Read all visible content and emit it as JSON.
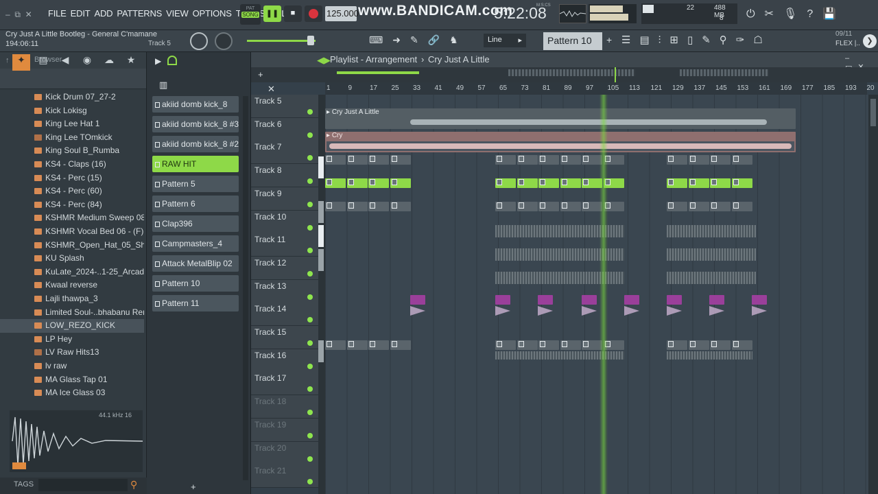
{
  "menu": [
    "FILE",
    "EDIT",
    "ADD",
    "PATTERNS",
    "VIEW",
    "OPTIONS",
    "TOOLS",
    "HELP"
  ],
  "transport": {
    "mode_pat": "PAT",
    "mode_song": "SONG",
    "tempo": "125.000",
    "time": "5:22:08",
    "time_label": "M:S:CS"
  },
  "watermark": "www.BANDICAM.com",
  "monitor": {
    "cpu": "22",
    "mem": "488 MB",
    "poly": "8"
  },
  "hint": {
    "title": "Cry Just A Little Bootleg - General C'mamane",
    "pos": "194:06:11",
    "track": "Track 5"
  },
  "snap": "Line",
  "pattern_selector": "Pattern 10",
  "date": "09/11",
  "flex": "FLEX |..",
  "browser": {
    "title": "Browser",
    "items": [
      {
        "label": "Kick Drum 07_27-2",
        "type": "file"
      },
      {
        "label": "Kick Lokisg",
        "type": "file"
      },
      {
        "label": "King Lee Hat 1",
        "type": "file"
      },
      {
        "label": "King Lee TOmkick",
        "type": "wav"
      },
      {
        "label": "King Soul B_Rumba",
        "type": "file"
      },
      {
        "label": "KS4 - Claps (16)",
        "type": "file"
      },
      {
        "label": "KS4 - Perc (15)",
        "type": "file"
      },
      {
        "label": "KS4 - Perc (60)",
        "type": "file"
      },
      {
        "label": "KS4 - Perc (84)",
        "type": "file"
      },
      {
        "label": "KSHMR Medium Sweep 08",
        "type": "file"
      },
      {
        "label": "KSHMR Vocal Bed 06 - (F)",
        "type": "file"
      },
      {
        "label": "KSHMR_Open_Hat_05_Short",
        "type": "file"
      },
      {
        "label": "KU Splash",
        "type": "file"
      },
      {
        "label": "KuLate_2024-..1-25_Arcade_2",
        "type": "file"
      },
      {
        "label": "Kwaal reverse",
        "type": "file"
      },
      {
        "label": "Lajli thawpa_3",
        "type": "file"
      },
      {
        "label": "Limited Soul-..bhabanu Remix",
        "type": "file"
      },
      {
        "label": "LOW_REZO_KICK",
        "type": "file",
        "selected": true
      },
      {
        "label": "LP Hey",
        "type": "file"
      },
      {
        "label": "LV Raw Hits13",
        "type": "wav"
      },
      {
        "label": "lv raw",
        "type": "file"
      },
      {
        "label": "MA Glass Tap 01",
        "type": "file"
      },
      {
        "label": "MA Ice Glass 03",
        "type": "file"
      }
    ],
    "sample_info": "44.1 kHz 16",
    "tags": "TAGS"
  },
  "patterns": [
    {
      "label": "akiid domb kick_8"
    },
    {
      "label": "akiid domb kick_8 #3"
    },
    {
      "label": "akiid domb kick_8 #2"
    },
    {
      "label": "RAW HIT",
      "active": true
    },
    {
      "label": "Pattern 5"
    },
    {
      "label": "Pattern 6"
    },
    {
      "label": "Clap396"
    },
    {
      "label": "Campmasters_4"
    },
    {
      "label": "Attack MetalBlip 02"
    },
    {
      "label": "Pattern 10"
    },
    {
      "label": "Pattern 11"
    }
  ],
  "playlist": {
    "title": "Playlist - Arrangement",
    "sep": "›",
    "song": "Cry Just A Little",
    "ruler": [
      "1",
      "9",
      "17",
      "25",
      "33",
      "41",
      "49",
      "57",
      "65",
      "73",
      "81",
      "89",
      "97",
      "105",
      "113",
      "121",
      "129",
      "137",
      "145",
      "153",
      "161",
      "169",
      "177",
      "185",
      "193",
      "20"
    ],
    "tracks": [
      "Track 5",
      "Track 6",
      "Track 7",
      "Track 8",
      "Track 9",
      "Track 10",
      "Track 11",
      "Track 12",
      "Track 13",
      "Track 14",
      "Track 15",
      "Track 16",
      "Track 17",
      "Track 18",
      "Track 19",
      "Track 20",
      "Track 21"
    ],
    "audio_clips": [
      "Cry Just A Little",
      "Cry"
    ]
  },
  "colors": {
    "accent": "#8ed948",
    "playhead": "#7be03a",
    "purple": "#9a3f9a"
  }
}
